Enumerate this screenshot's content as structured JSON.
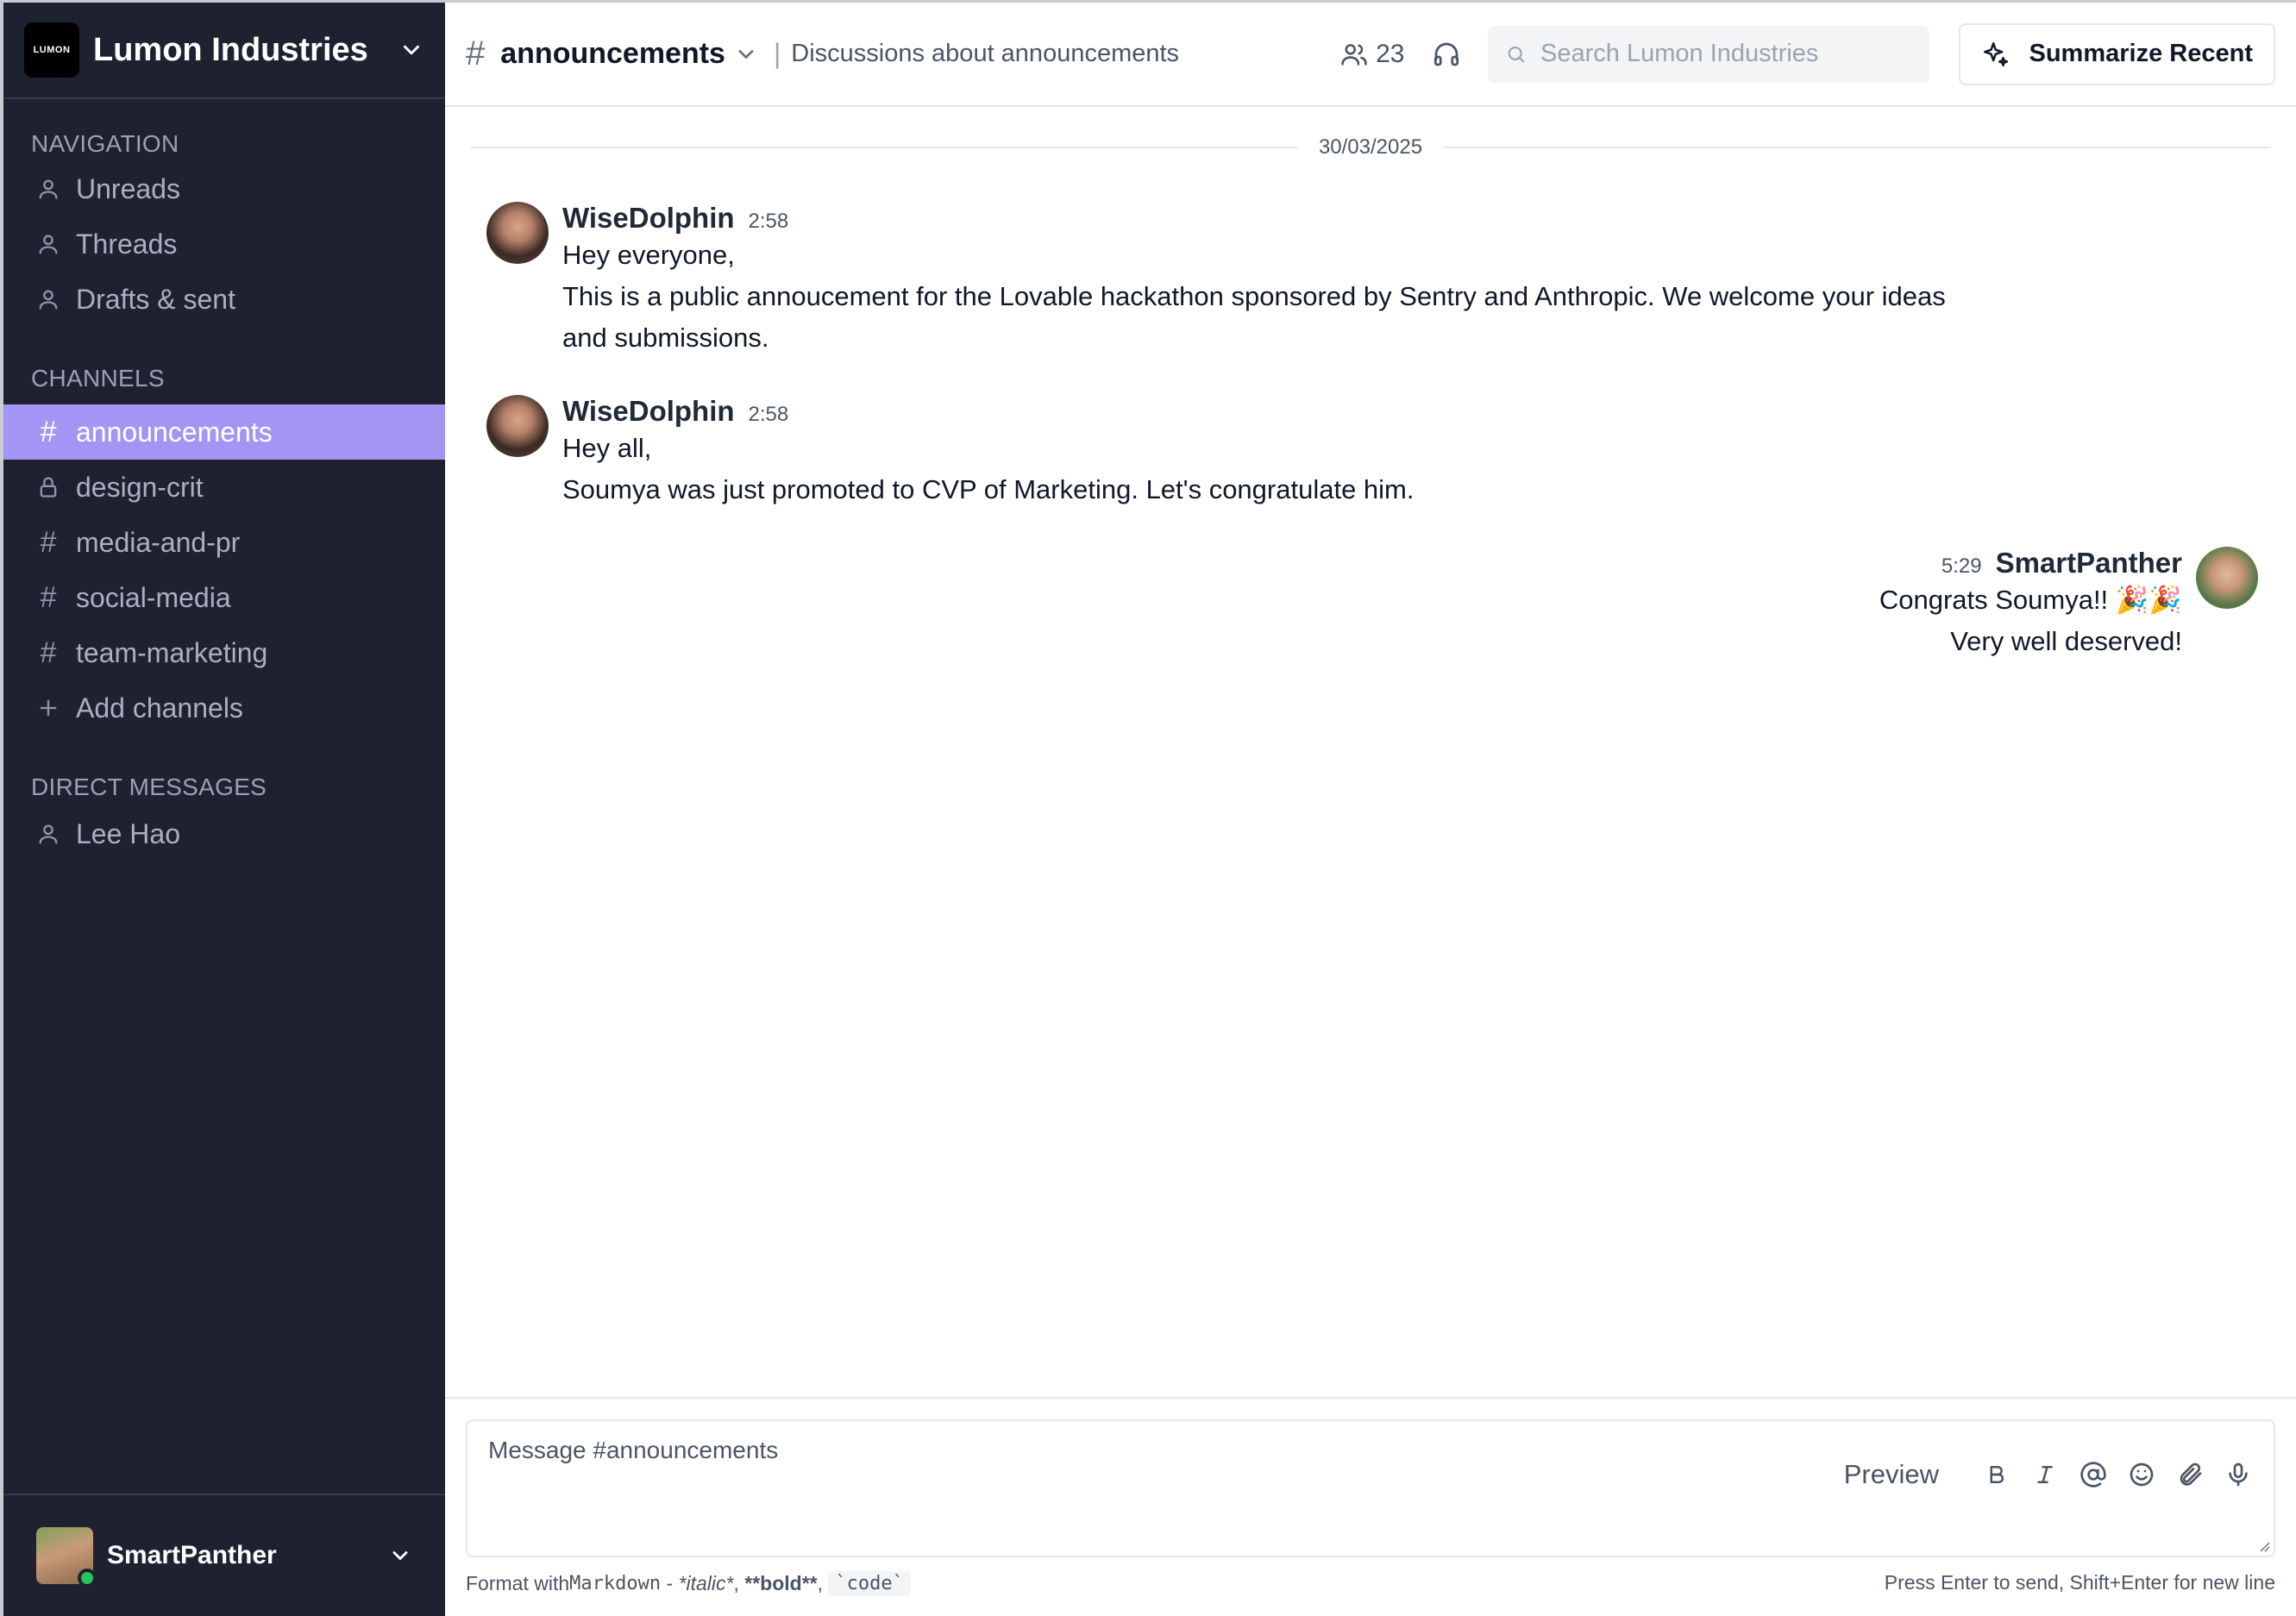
{
  "workspace": {
    "name": "Lumon Industries",
    "logo_text": "LUMON"
  },
  "sidebar": {
    "navigation_title": "NAVIGATION",
    "navigation": [
      {
        "label": "Unreads",
        "icon": "user-icon"
      },
      {
        "label": "Threads",
        "icon": "user-icon"
      },
      {
        "label": "Drafts & sent",
        "icon": "user-icon"
      }
    ],
    "channels_title": "CHANNELS",
    "channels": [
      {
        "label": "announcements",
        "icon": "hash-icon",
        "active": true
      },
      {
        "label": "design-crit",
        "icon": "lock-icon"
      },
      {
        "label": "media-and-pr",
        "icon": "hash-icon"
      },
      {
        "label": "social-media",
        "icon": "hash-icon"
      },
      {
        "label": "team-marketing",
        "icon": "hash-icon"
      }
    ],
    "add_channels": "Add channels",
    "dm_title": "DIRECT MESSAGES",
    "direct_messages": [
      {
        "label": "Lee Hao",
        "icon": "user-icon"
      }
    ],
    "current_user": {
      "name": "SmartPanther",
      "status": "online"
    },
    "active_color": "#a495f5",
    "background_color": "#1e2130"
  },
  "header": {
    "channel": "announcements",
    "description": "Discussions about announcements",
    "member_count": "23",
    "search_placeholder": "Search Lumon Industries",
    "summarize_label": "Summarize Recent"
  },
  "messages": {
    "date_divider": "30/03/2025",
    "items": [
      {
        "author": "WiseDolphin",
        "time": "2:58",
        "lines": [
          "Hey everyone,",
          "This is a public annoucement for the Lovable hackathon sponsored by Sentry and Anthropic. We welcome your ideas",
          "and submissions."
        ],
        "align": "left"
      },
      {
        "author": "WiseDolphin",
        "time": "2:58",
        "lines": [
          "Hey all,",
          "Soumya was just promoted to CVP of Marketing. Let's congratulate him."
        ],
        "align": "left"
      },
      {
        "author": "SmartPanther",
        "time": "5:29",
        "lines": [
          "Congrats Soumya!! 🎉🎉",
          "Very well deserved!"
        ],
        "align": "right"
      }
    ]
  },
  "composer": {
    "placeholder": "Message #announcements",
    "preview_label": "Preview",
    "hint_prefix": "Format with ",
    "hint_markdown": "Markdown",
    "hint_sep": " - ",
    "hint_italic": "*italic*",
    "hint_comma1": ", ",
    "hint_bold": "**bold**",
    "hint_comma2": ", ",
    "hint_code": "`code`",
    "hint_right": "Press Enter to send, Shift+Enter for new line"
  }
}
